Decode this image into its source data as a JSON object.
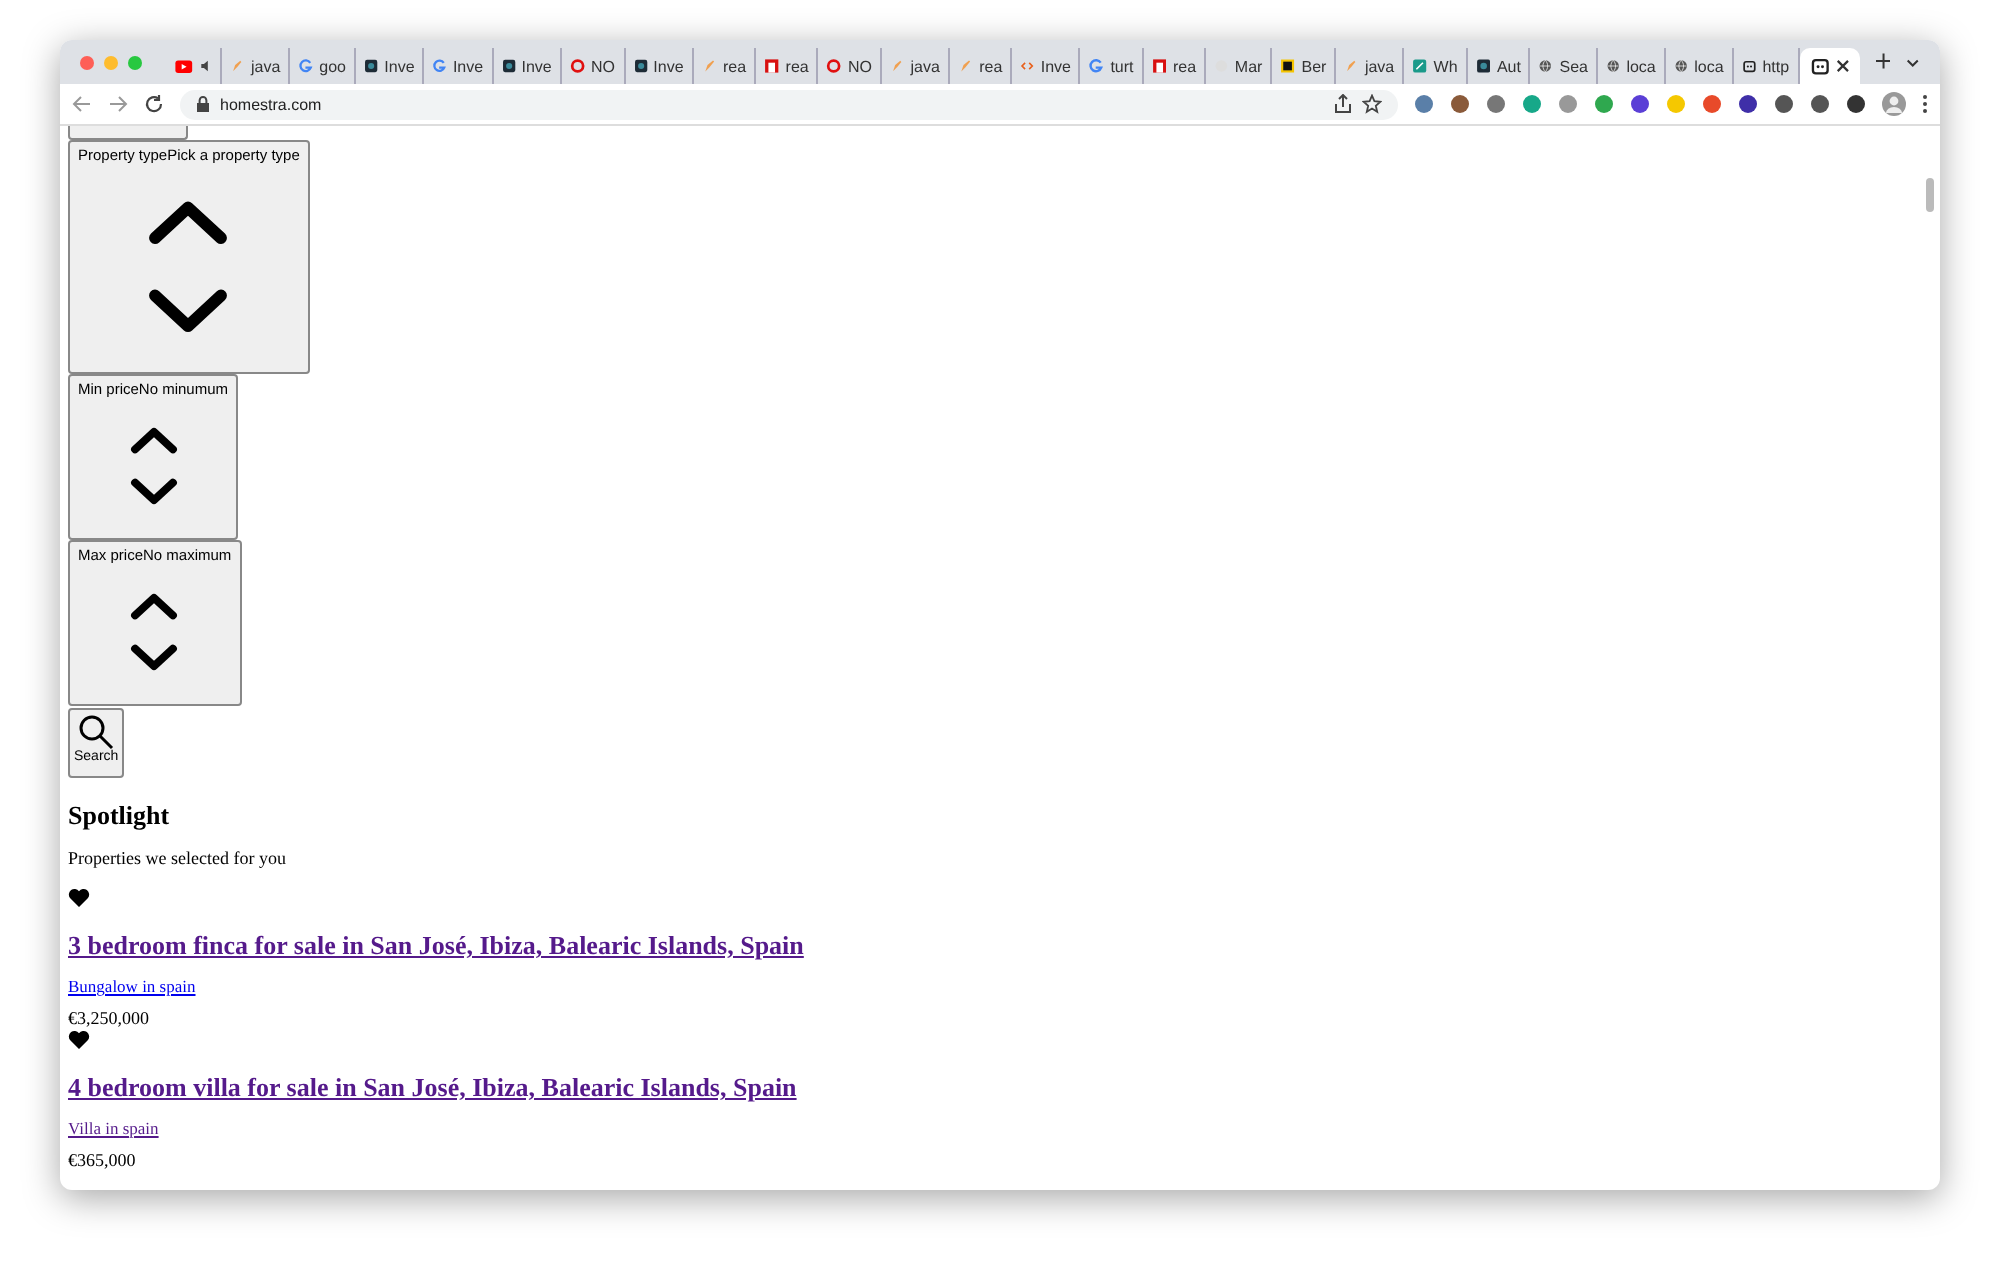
{
  "browser": {
    "tabs": [
      {
        "kind": "youtube",
        "audio": true,
        "selected": false
      },
      {
        "kind": "pencil",
        "label": "java",
        "audio": false,
        "selected": false
      },
      {
        "kind": "google",
        "label": "goo",
        "audio": false,
        "selected": false
      },
      {
        "kind": "dark",
        "label": "Inve",
        "audio": false,
        "selected": false
      },
      {
        "kind": "google",
        "label": "Inve",
        "audio": false,
        "selected": false
      },
      {
        "kind": "dark",
        "label": "Inve",
        "audio": false,
        "selected": false
      },
      {
        "kind": "ring",
        "label": "NO",
        "audio": false,
        "selected": false
      },
      {
        "kind": "dark",
        "label": "Inve",
        "audio": false,
        "selected": false
      },
      {
        "kind": "pencil",
        "label": "rea",
        "audio": false,
        "selected": false
      },
      {
        "kind": "square",
        "label": "rea",
        "audio": false,
        "selected": false
      },
      {
        "kind": "ring",
        "label": "NO",
        "audio": false,
        "selected": false
      },
      {
        "kind": "pencil",
        "label": "java",
        "audio": false,
        "selected": false
      },
      {
        "kind": "pencil",
        "label": "rea",
        "audio": false,
        "selected": false
      },
      {
        "kind": "code",
        "label": "Inve",
        "audio": false,
        "selected": false
      },
      {
        "kind": "google",
        "label": "turt",
        "audio": false,
        "selected": false
      },
      {
        "kind": "square",
        "label": "rea",
        "audio": false,
        "selected": false
      },
      {
        "kind": "cat",
        "label": "Mar",
        "audio": false,
        "selected": false
      },
      {
        "kind": "boxed",
        "label": "Ber",
        "audio": false,
        "selected": false
      },
      {
        "kind": "pencil",
        "label": "java",
        "audio": false,
        "selected": false
      },
      {
        "kind": "teal",
        "label": "Wh",
        "audio": false,
        "selected": false
      },
      {
        "kind": "dark",
        "label": "Aut",
        "audio": false,
        "selected": false
      },
      {
        "kind": "globe",
        "label": "Sea",
        "audio": false,
        "selected": false
      },
      {
        "kind": "globe",
        "label": "loca",
        "audio": false,
        "selected": false
      },
      {
        "kind": "globe",
        "label": "loca",
        "audio": false,
        "selected": false
      },
      {
        "kind": "robot",
        "label": "http",
        "audio": false,
        "selected": false
      },
      {
        "kind": "robot",
        "audio": false,
        "selected": true
      }
    ],
    "address": "homestra.com"
  },
  "search_form": {
    "fields": [
      {
        "label": "Property typePick a property type",
        "kind": "large"
      },
      {
        "label": "Min priceNo minumum",
        "kind": "small"
      },
      {
        "label": "Max priceNo maximum",
        "kind": "small"
      }
    ],
    "search_button": "Search"
  },
  "spotlight": {
    "title": "Spotlight",
    "subtitle": "Properties we selected for you",
    "listings": [
      {
        "title": "3 bedroom finca for sale in San José, Ibiza, Balearic Islands, Spain",
        "type": "Bungalow in spain",
        "type_visited": false,
        "price": "€3,250,000"
      },
      {
        "title": "4 bedroom villa for sale in San José, Ibiza, Balearic Islands, Spain",
        "type": "Villa in spain",
        "type_visited": true,
        "price": "€365,000"
      }
    ]
  }
}
